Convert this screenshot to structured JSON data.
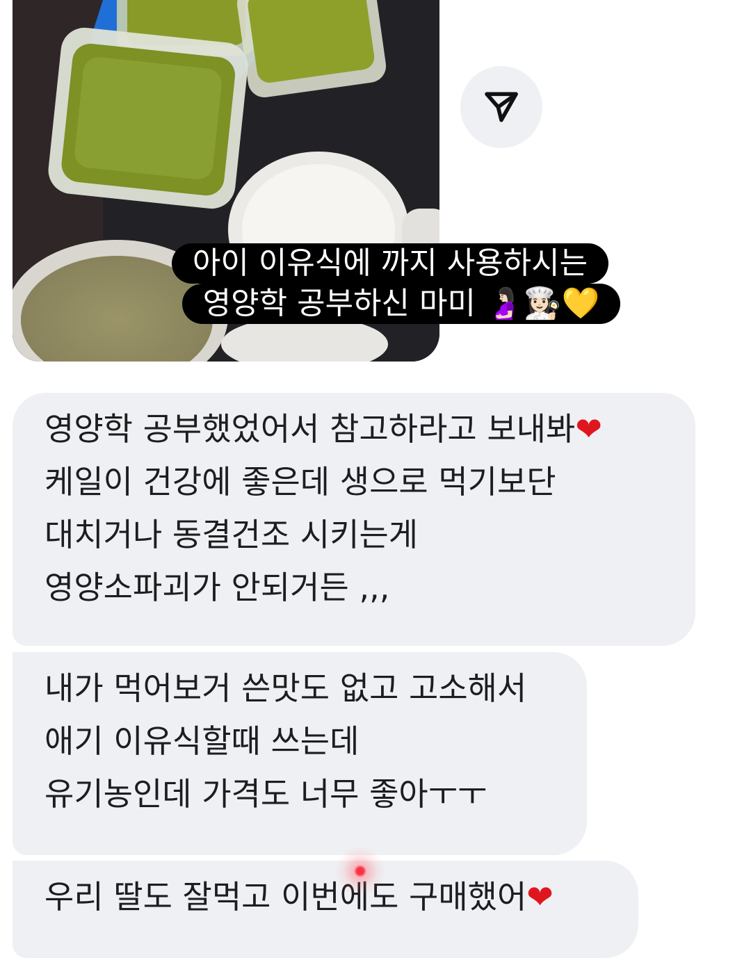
{
  "photo": {
    "icon": "food-photo"
  },
  "share_icon": "send-icon",
  "caption": {
    "line1": "아이 이유식에 까지 사용하시는",
    "line2_text": "영양학 공부하신 마미",
    "line2_emoji": "🤰🏻👩🏻‍🍳💛"
  },
  "messages": [
    {
      "lines": [
        "영양학 공부했었어서 참고하라고 보내봐",
        "케일이 건강에 좋은데 생으로 먹기보단",
        "대치거나 동결건조 시키는게",
        "영양소파괴가 안되거든 ,,,"
      ],
      "heart": "❤"
    },
    {
      "lines": [
        "내가 먹어보거 쓴맛도 없고 고소해서",
        "애기 이유식할때 쓰는데",
        "유기농인데 가격도 너무 좋아ㅜㅜ"
      ]
    },
    {
      "lines": [
        "우리 딸도 잘먹고 이번에도 구매했어"
      ],
      "heart": "❤"
    }
  ],
  "colors": {
    "bubble": "#eef0f3",
    "caption_bg": "#000000",
    "heart": "#e0161f"
  }
}
